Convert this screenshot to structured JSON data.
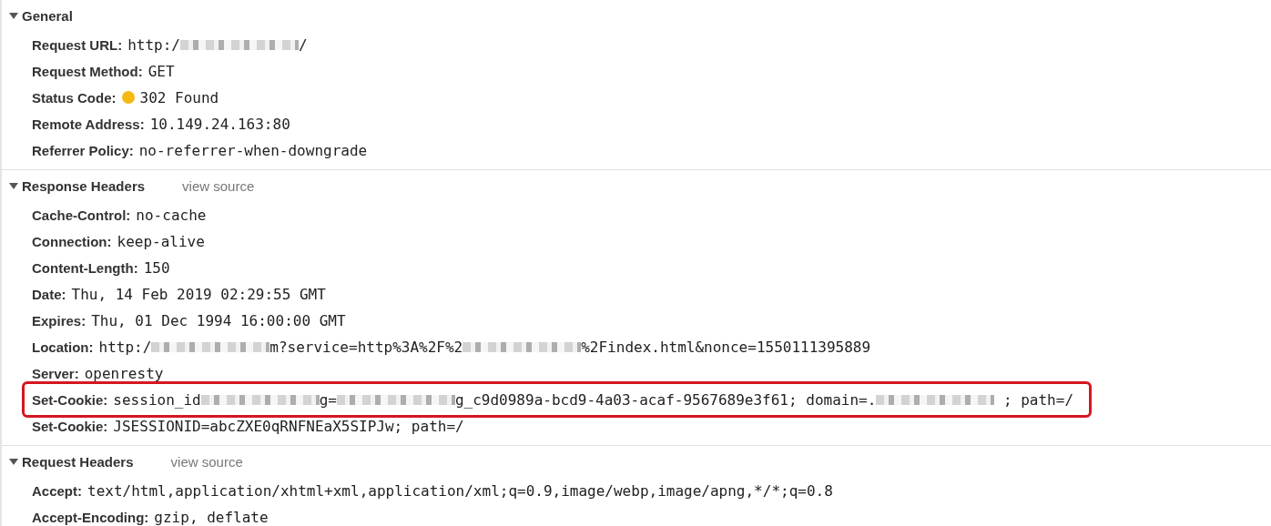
{
  "sections": [
    {
      "title": "General",
      "expanded": true,
      "rows": [
        {
          "label": "Request URL:",
          "highlighted": false,
          "value": [
            {
              "kind": "text",
              "text": "http:/"
            },
            {
              "kind": "redacted"
            },
            {
              "kind": "text",
              "text": "/"
            }
          ]
        },
        {
          "label": "Request Method:",
          "highlighted": false,
          "value": [
            {
              "kind": "text",
              "text": "GET"
            }
          ]
        },
        {
          "label": "Status Code:",
          "highlighted": false,
          "value": [
            {
              "kind": "dot",
              "color": "#f5b914"
            },
            {
              "kind": "text",
              "text": "302 Found"
            }
          ]
        },
        {
          "label": "Remote Address:",
          "highlighted": false,
          "value": [
            {
              "kind": "text",
              "text": "10.149.24.163:80"
            }
          ]
        },
        {
          "label": "Referrer Policy:",
          "highlighted": false,
          "value": [
            {
              "kind": "text",
              "text": "no-referrer-when-downgrade"
            }
          ]
        }
      ]
    },
    {
      "title": "Response Headers",
      "link": "view source",
      "expanded": true,
      "rows": [
        {
          "label": "Cache-Control:",
          "highlighted": false,
          "value": [
            {
              "kind": "text",
              "text": "no-cache"
            }
          ]
        },
        {
          "label": "Connection:",
          "highlighted": false,
          "value": [
            {
              "kind": "text",
              "text": "keep-alive"
            }
          ]
        },
        {
          "label": "Content-Length:",
          "highlighted": false,
          "value": [
            {
              "kind": "text",
              "text": "150"
            }
          ]
        },
        {
          "label": "Date:",
          "highlighted": false,
          "value": [
            {
              "kind": "text",
              "text": "Thu, 14 Feb 2019 02:29:55 GMT"
            }
          ]
        },
        {
          "label": "Expires:",
          "highlighted": false,
          "value": [
            {
              "kind": "text",
              "text": "Thu, 01 Dec 1994 16:00:00 GMT"
            }
          ]
        },
        {
          "label": "Location:",
          "highlighted": false,
          "value": [
            {
              "kind": "text",
              "text": "http:/"
            },
            {
              "kind": "redacted"
            },
            {
              "kind": "text",
              "text": "m?service=http%3A%2F%2"
            },
            {
              "kind": "redacted"
            },
            {
              "kind": "text",
              "text": "%2Findex.html&nonce=1550111395889"
            }
          ]
        },
        {
          "label": "Server:",
          "highlighted": false,
          "value": [
            {
              "kind": "text",
              "text": "openresty"
            }
          ]
        },
        {
          "label": "Set-Cookie:",
          "highlighted": true,
          "value": [
            {
              "kind": "text",
              "text": "session_id"
            },
            {
              "kind": "redacted"
            },
            {
              "kind": "text",
              "text": "g="
            },
            {
              "kind": "redacted"
            },
            {
              "kind": "text",
              "text": "g_c9d0989a-bcd9-4a03-acaf-9567689e3f61; domain=."
            },
            {
              "kind": "redacted"
            },
            {
              "kind": "text",
              "text": " ; path=/"
            }
          ]
        },
        {
          "label": "Set-Cookie:",
          "highlighted": false,
          "value": [
            {
              "kind": "text",
              "text": "JSESSIONID=abcZXE0qRNFNEaX5SIPJw; path=/"
            }
          ]
        }
      ]
    },
    {
      "title": "Request Headers",
      "link": "view source",
      "expanded": true,
      "rows": [
        {
          "label": "Accept:",
          "highlighted": false,
          "value": [
            {
              "kind": "text",
              "text": "text/html,application/xhtml+xml,application/xml;q=0.9,image/webp,image/apng,*/*;q=0.8"
            }
          ]
        },
        {
          "label": "Accept-Encoding:",
          "highlighted": false,
          "value": [
            {
              "kind": "text",
              "text": "gzip, deflate"
            }
          ]
        }
      ]
    }
  ]
}
